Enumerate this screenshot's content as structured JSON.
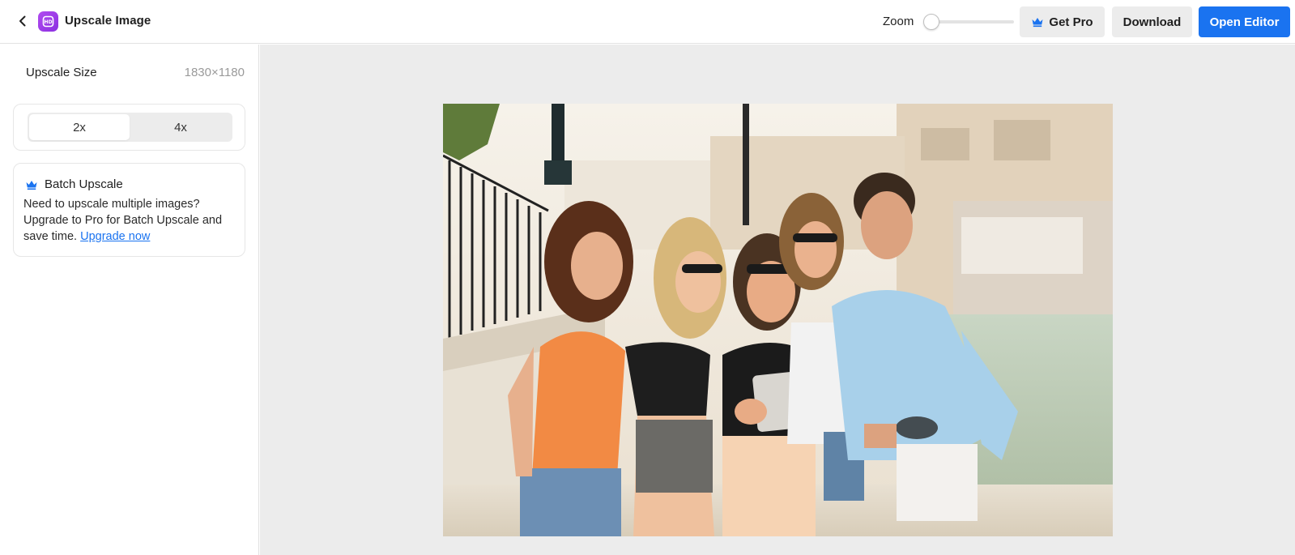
{
  "header": {
    "back_icon": "chevron-left-icon",
    "logo_icon": "upscale-app-icon",
    "title": "Upscale Image",
    "zoom_label": "Zoom",
    "zoom_value": 0,
    "get_pro_icon": "crown-icon",
    "get_pro_label": "Get Pro",
    "download_label": "Download",
    "open_editor_label": "Open Editor"
  },
  "sidebar": {
    "size_label": "Upscale Size",
    "size_value": "1830×1180",
    "scale_options": [
      {
        "label": "2x",
        "selected": true
      },
      {
        "label": "4x",
        "selected": false
      }
    ],
    "batch": {
      "icon": "crown-icon",
      "title": "Batch Upscale",
      "text": "Need to upscale multiple images? Upgrade to Pro for Batch Upscale and save time.",
      "link": "Upgrade now"
    }
  },
  "canvas": {
    "image": "photo of five friends smiling at a tablet on a sunny waterfront promenade"
  },
  "colors": {
    "accent": "#1a73f0",
    "logo": "#a23de8",
    "canvas_bg": "#ececec",
    "button_bg": "#ececec"
  }
}
